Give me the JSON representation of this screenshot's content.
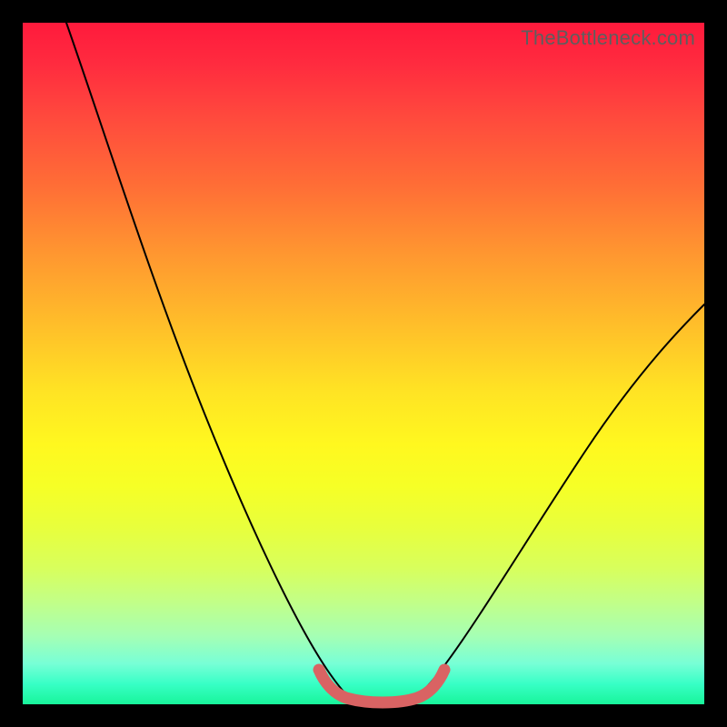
{
  "watermark": "TheBottleneck.com",
  "chart_data": {
    "type": "line",
    "title": "",
    "xlabel": "",
    "ylabel": "",
    "xlim": [
      0,
      100
    ],
    "ylim": [
      0,
      100
    ],
    "grid": false,
    "series": [
      {
        "name": "bottleneck-curve",
        "x": [
          0,
          5,
          10,
          15,
          20,
          25,
          30,
          35,
          40,
          43,
          46,
          49,
          52,
          55,
          58,
          63,
          70,
          80,
          90,
          100
        ],
        "values": [
          100,
          89,
          78,
          67,
          56,
          45,
          34,
          22,
          10,
          3,
          1,
          0,
          0,
          1,
          3,
          10,
          22,
          37,
          48,
          57
        ]
      },
      {
        "name": "optimal-zone-marker",
        "x": [
          42.5,
          44,
          46,
          49,
          52,
          55,
          57,
          58.5
        ],
        "values": [
          4.5,
          2,
          0.8,
          0.3,
          0.3,
          0.8,
          2,
          4.5
        ]
      }
    ]
  },
  "colors": {
    "curve": "#000000",
    "marker": "#d96363",
    "gradient_top": "#ff1a3c",
    "gradient_mid": "#ffe324",
    "gradient_bottom": "#18f59a"
  }
}
